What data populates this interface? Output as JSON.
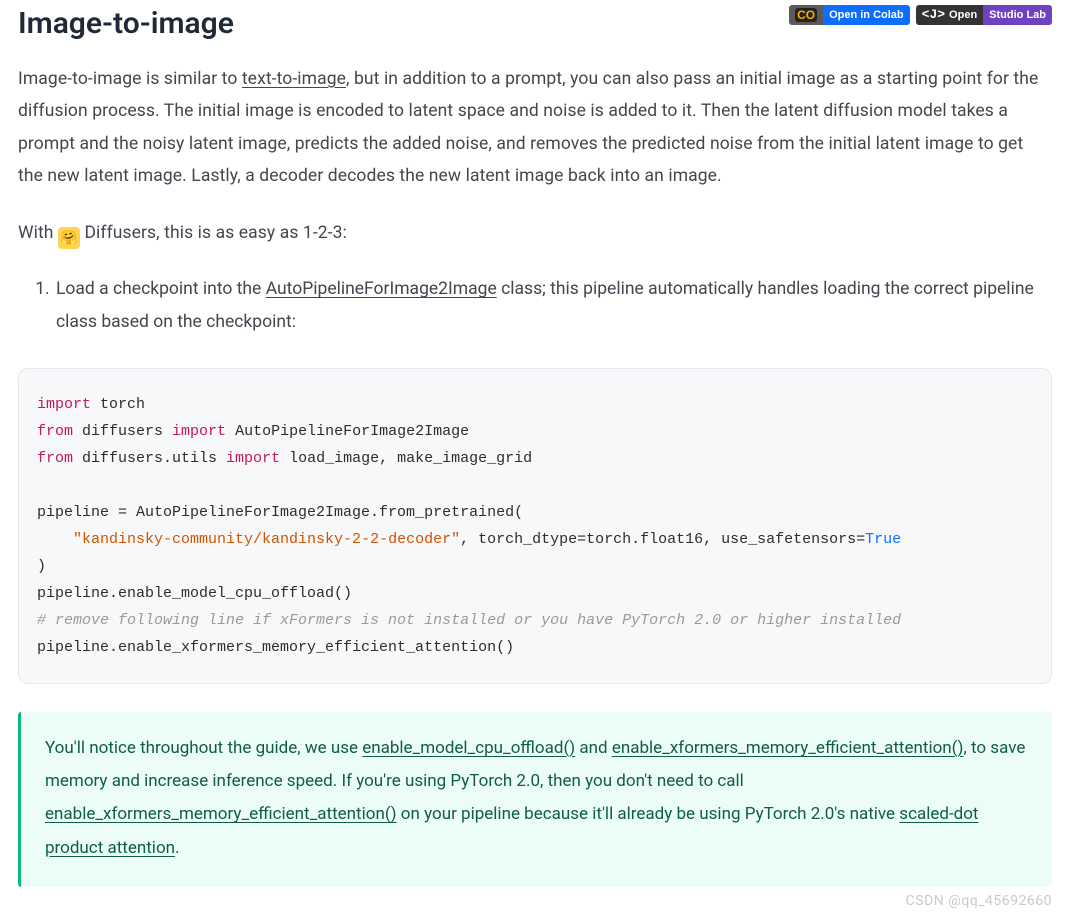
{
  "header": {
    "title": "Image-to-image",
    "badges": {
      "colab_left": "CO",
      "colab_right": "Open in Colab",
      "studio_left": "Open",
      "studio_right": "Studio Lab"
    }
  },
  "intro": {
    "p1_a": "Image-to-image is similar to ",
    "link_text_to_image": "text-to-image",
    "p1_b": ", but in addition to a prompt, you can also pass an initial image as a starting point for the diffusion process. The initial image is encoded to latent space and noise is added to it. Then the latent diffusion model takes a prompt and the noisy latent image, predicts the added noise, and removes the predicted noise from the initial latent image to get the new latent image. Lastly, a decoder decodes the new latent image back into an image.",
    "p2_a": "With ",
    "p2_b": " Diffusers, this is as easy as 1-2-3:"
  },
  "steps": {
    "s1_a": "Load a checkpoint into the ",
    "s1_link": "AutoPipelineForImage2Image",
    "s1_b": " class; this pipeline automatically handles loading the correct pipeline class based on the checkpoint:"
  },
  "code": {
    "import": "import",
    "from": "from",
    "torch": " torch",
    "diffusers": " diffusers ",
    "auto": " AutoPipelineForImage2Image",
    "du": " diffusers.utils ",
    "loads": " load_image, make_image_grid",
    "l5": "pipeline = AutoPipelineForImage2Image.from_pretrained(",
    "l6_pad": "    ",
    "l6_str": "\"kandinsky-community/kandinsky-2-2-decoder\"",
    "l6_mid": ", torch_dtype=torch.float16, use_safetensors=",
    "l6_bool": "True",
    "l7": ")",
    "l8": "pipeline.enable_model_cpu_offload()",
    "l9": "# remove following line if xFormers is not installed or you have PyTorch 2.0 or higher installed",
    "l10": "pipeline.enable_xformers_memory_efficient_attention()"
  },
  "tip": {
    "a": "You'll notice throughout the guide, we use ",
    "l1": "enable_model_cpu_offload()",
    "b": " and ",
    "l2": "enable_xformers_memory_efficient_attention()",
    "c": ", to save memory and increase inference speed. If you're using PyTorch 2.0, then you don't need to call ",
    "l3": "enable_xformers_memory_efficient_attention()",
    "d": " on your pipeline because it'll already be using PyTorch 2.0's native ",
    "l4": "scaled-dot product attention",
    "e": "."
  },
  "watermark": "CSDN @qq_45692660"
}
